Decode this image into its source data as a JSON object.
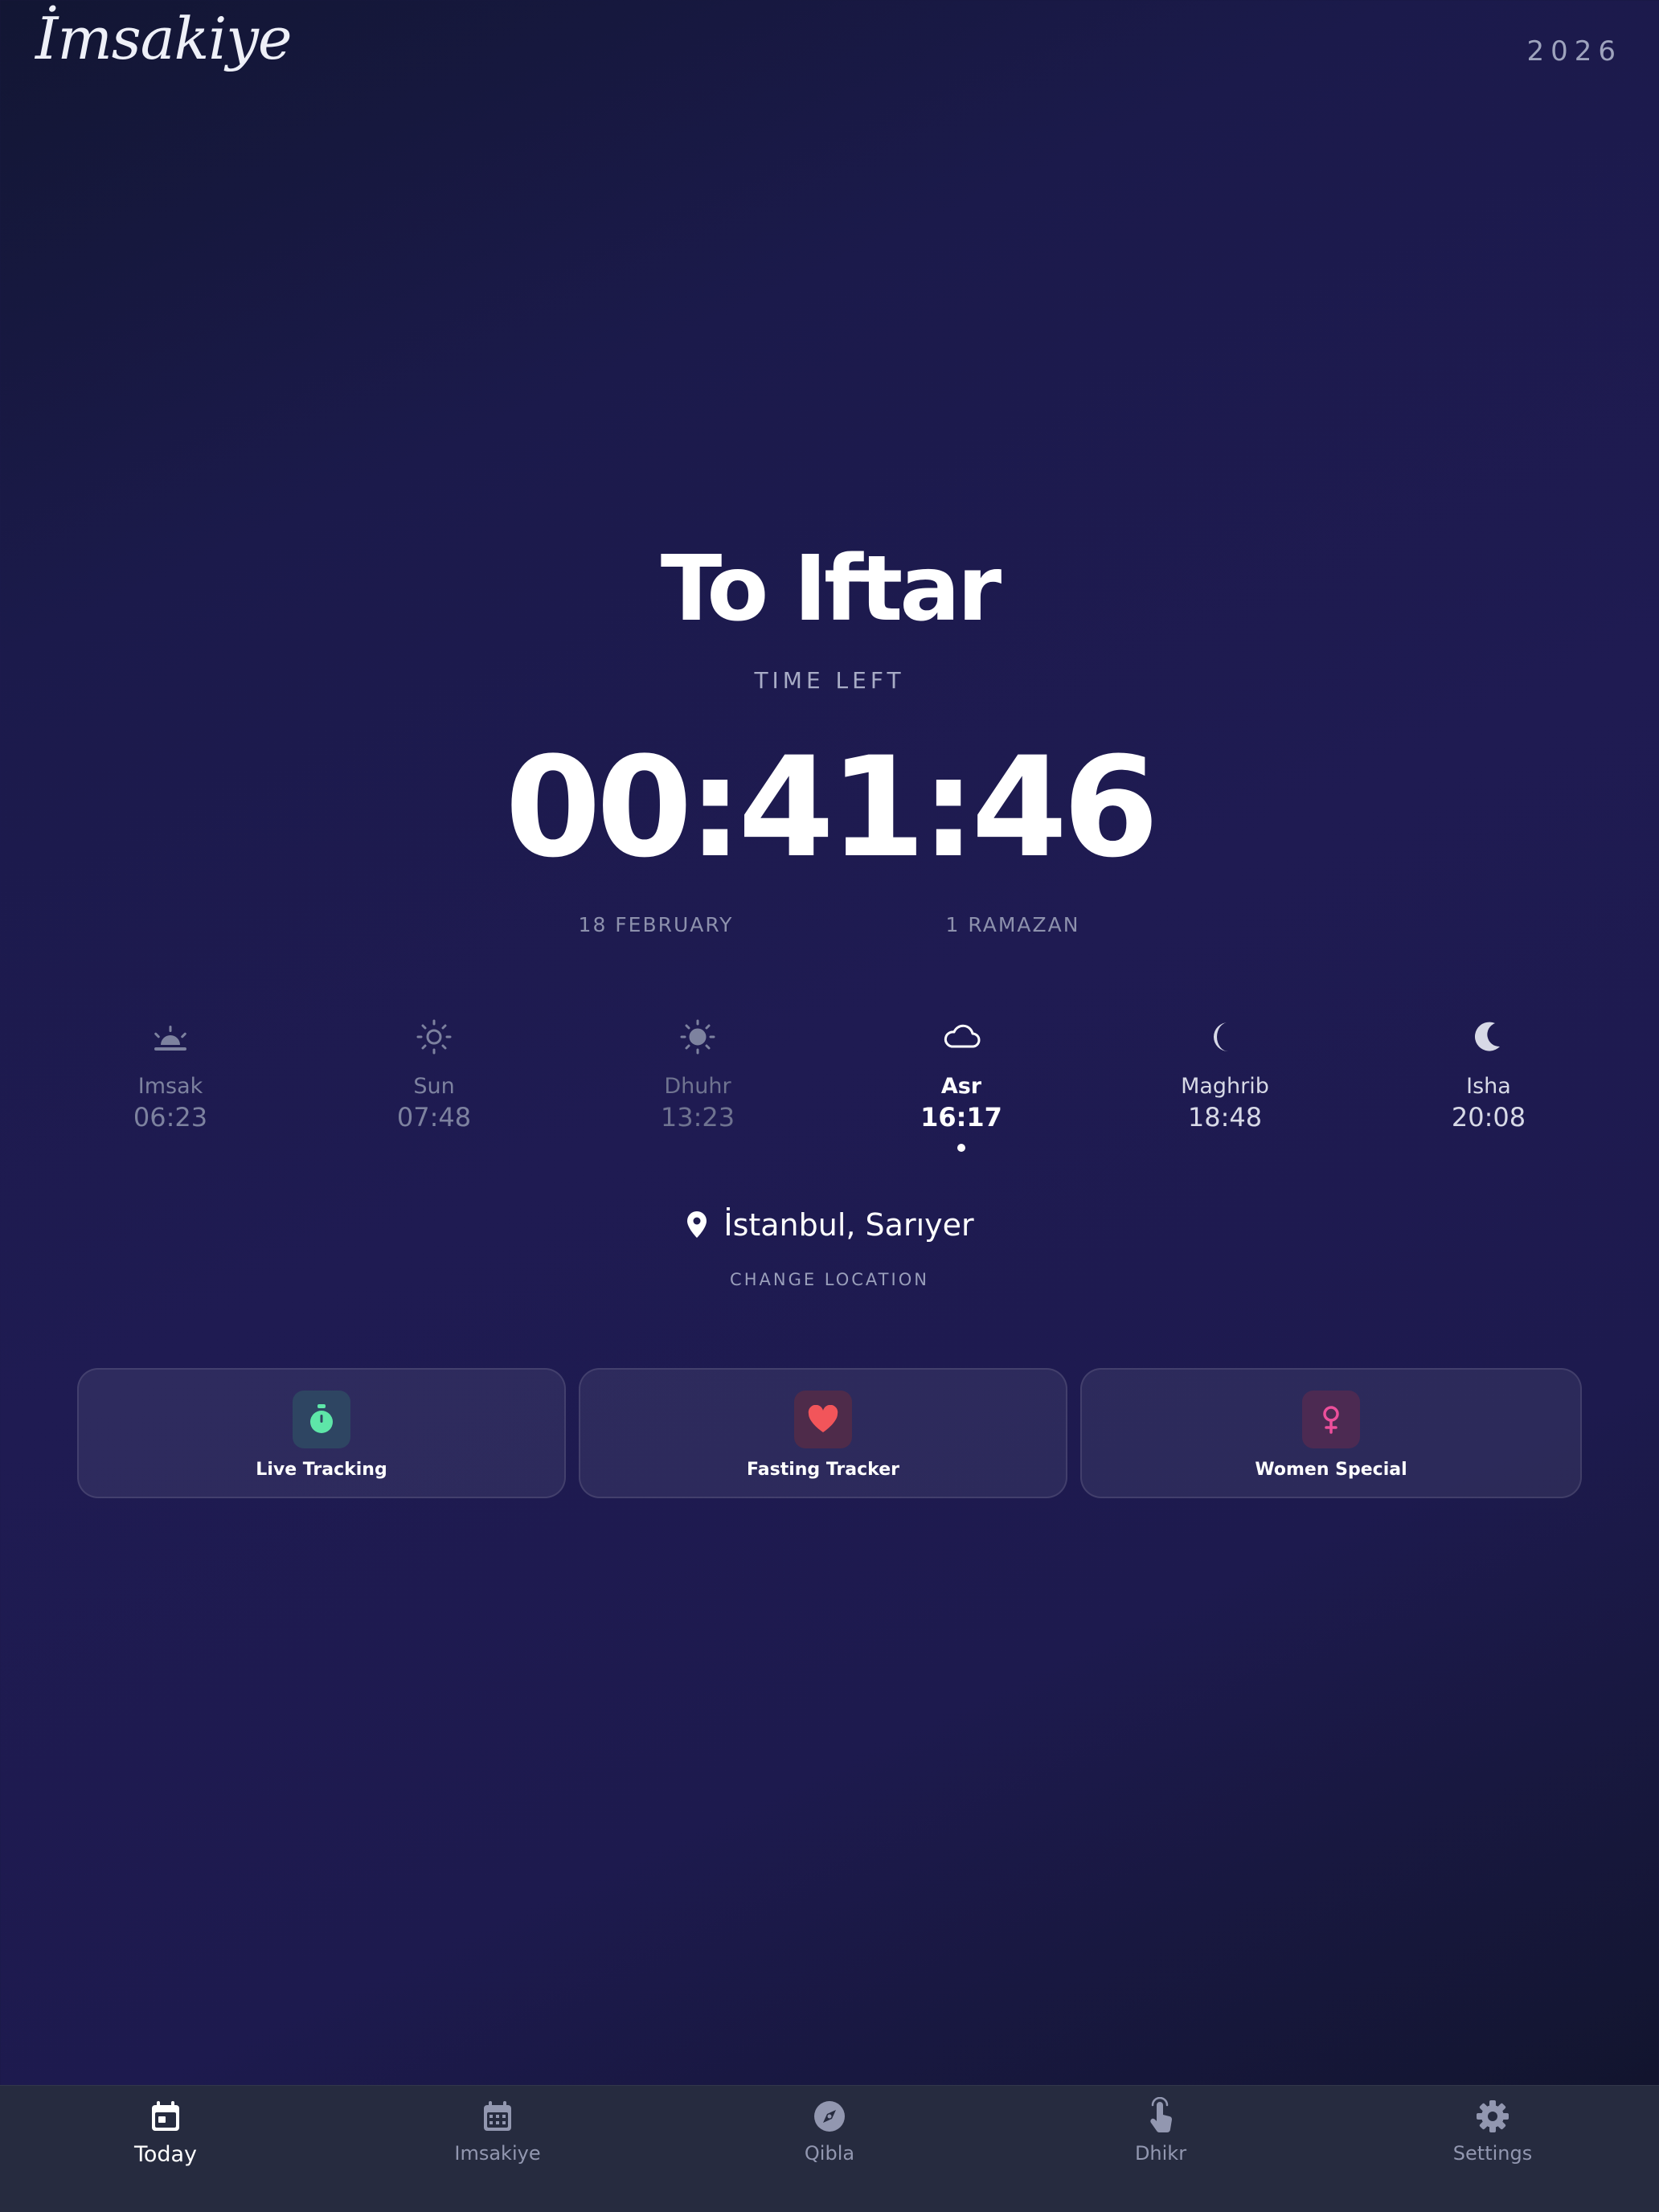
{
  "header": {
    "brand": "İmsakiye",
    "year": "2026"
  },
  "hero": {
    "title": "To Iftar",
    "subtitle": "TIME LEFT",
    "countdown": "00:41:46",
    "date_gregorian": "18 FEBRUARY",
    "date_hijri": "1 RAMAZAN"
  },
  "prayers": [
    {
      "name": "Imsak",
      "time": "06:23",
      "icon": "sunrise-icon"
    },
    {
      "name": "Sun",
      "time": "07:48",
      "icon": "sun-outline-icon"
    },
    {
      "name": "Dhuhr",
      "time": "13:23",
      "icon": "sun-filled-icon"
    },
    {
      "name": "Asr",
      "time": "16:17",
      "icon": "cloud-icon",
      "active": true
    },
    {
      "name": "Maghrib",
      "time": "18:48",
      "icon": "crescent-moon-icon"
    },
    {
      "name": "Isha",
      "time": "20:08",
      "icon": "moon-icon"
    }
  ],
  "location": {
    "name": "İstanbul, Sarıyer",
    "change_label": "CHANGE LOCATION"
  },
  "cards": [
    {
      "label": "Live Tracking",
      "icon": "stopwatch-icon",
      "color": "#5ee6a8"
    },
    {
      "label": "Fasting Tracker",
      "icon": "heart-icon",
      "color": "#f2555a"
    },
    {
      "label": "Women Special",
      "icon": "female-icon",
      "color": "#ec4f9b"
    }
  ],
  "nav": [
    {
      "label": "Today",
      "icon": "calendar-today-icon",
      "selected": true
    },
    {
      "label": "Imsakiye",
      "icon": "calendar-grid-icon"
    },
    {
      "label": "Qibla",
      "icon": "compass-icon"
    },
    {
      "label": "Dhikr",
      "icon": "tap-hand-icon"
    },
    {
      "label": "Settings",
      "icon": "gear-icon"
    }
  ]
}
